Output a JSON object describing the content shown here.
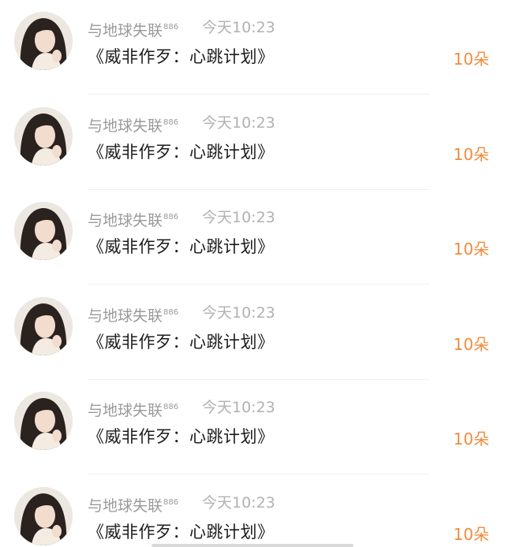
{
  "list": {
    "items": [
      {
        "sender": "与地球失联",
        "badge": "886",
        "time": "今天10:23",
        "gift": "《威非作歹：心跳计划》",
        "amount": "10朵"
      },
      {
        "sender": "与地球失联",
        "badge": "886",
        "time": "今天10:23",
        "gift": "《威非作歹：心跳计划》",
        "amount": "10朵"
      },
      {
        "sender": "与地球失联",
        "badge": "886",
        "time": "今天10:23",
        "gift": "《威非作歹：心跳计划》",
        "amount": "10朵"
      },
      {
        "sender": "与地球失联",
        "badge": "886",
        "time": "今天10:23",
        "gift": "《威非作歹：心跳计划》",
        "amount": "10朵"
      },
      {
        "sender": "与地球失联",
        "badge": "886",
        "time": "今天10:23",
        "gift": "《威非作歹：心跳计划》",
        "amount": "10朵"
      },
      {
        "sender": "与地球失联",
        "badge": "886",
        "time": "今天10:23",
        "gift": "《威非作歹：心跳计划》",
        "amount": "10朵"
      }
    ]
  },
  "colors": {
    "amount": "#f08b3c",
    "name": "#9a9a9a",
    "time": "#b1b1b1",
    "title": "#1c1c1c"
  },
  "icons": {
    "avatar": "user-avatar-photo"
  }
}
